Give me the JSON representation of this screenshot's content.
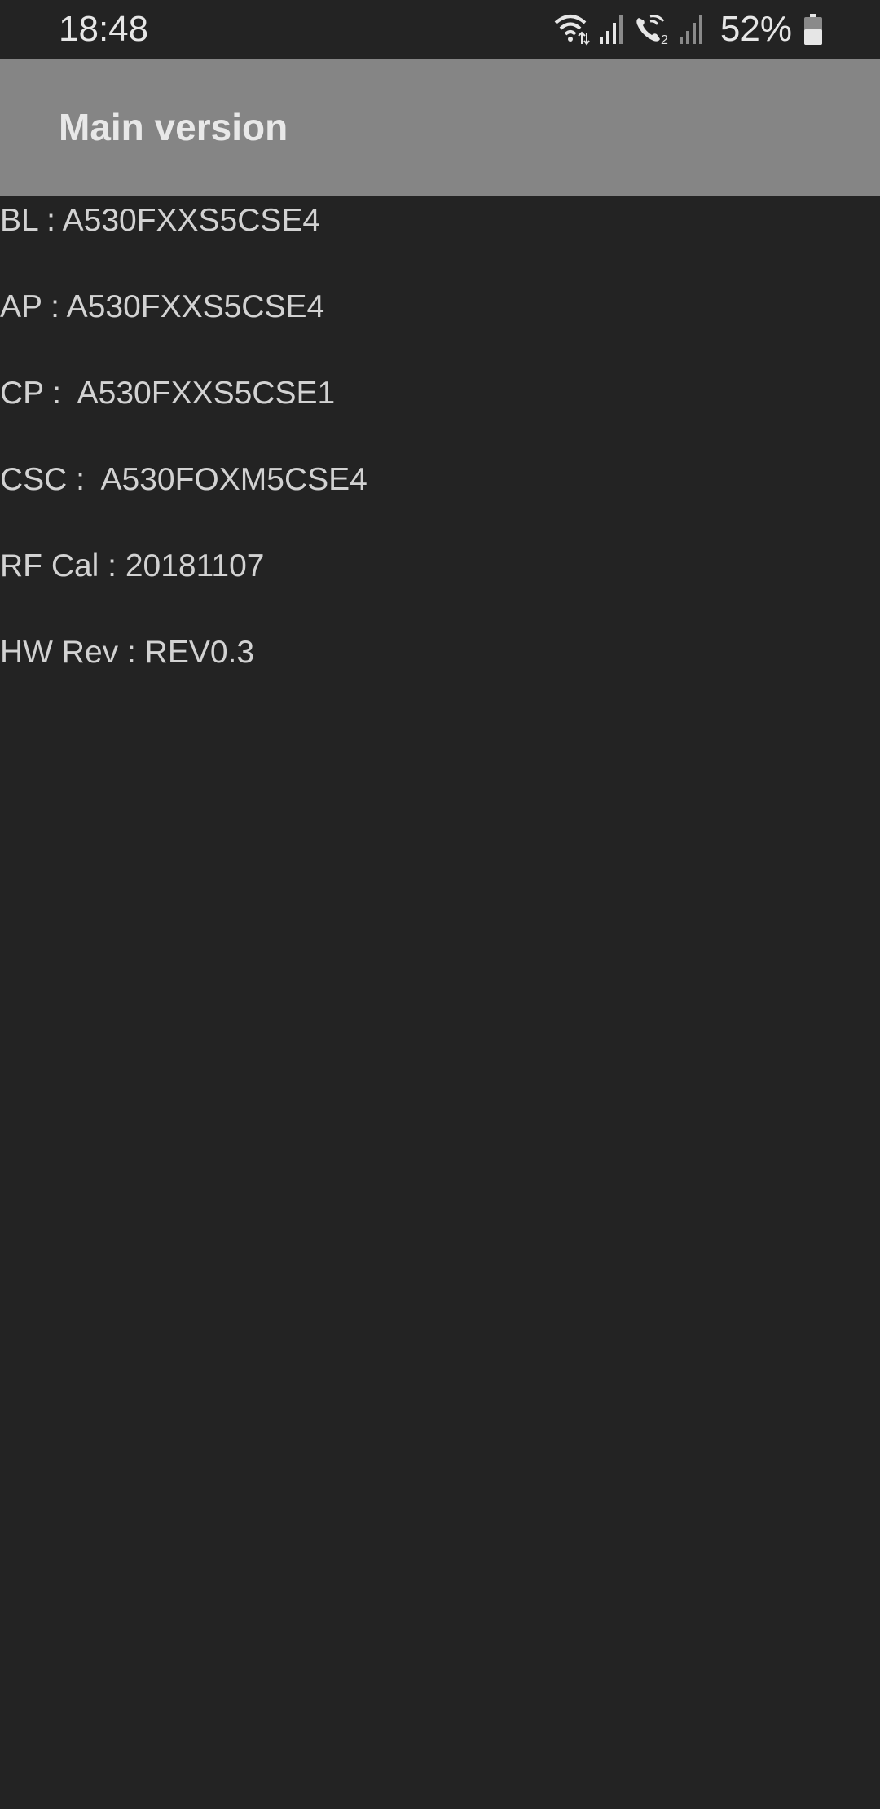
{
  "status_bar": {
    "time": "18:48",
    "battery_percent": "52%",
    "icons": [
      "wifi-icon",
      "signal-icon",
      "wifi-calling-icon",
      "signal-icon",
      "battery-icon"
    ],
    "sim_label": "2"
  },
  "app_bar": {
    "title": "Main version"
  },
  "info": {
    "rows": [
      {
        "text": "BL : A530FXXS5CSE4"
      },
      {
        "text": "AP : A530FXXS5CSE4"
      },
      {
        "text": "CP :  A530FXXS5CSE1"
      },
      {
        "text": "CSC :  A530FOXM5CSE4"
      },
      {
        "text": "RF Cal : 20181107"
      },
      {
        "text": "HW Rev : REV0.3"
      }
    ]
  },
  "colors": {
    "background": "#232323",
    "app_bar": "#858585",
    "text": "#d2d2d2"
  }
}
